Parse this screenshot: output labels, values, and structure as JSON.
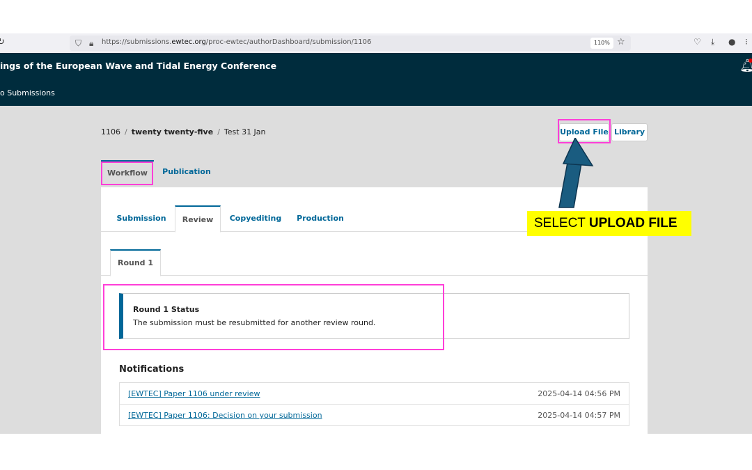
{
  "browser": {
    "url_prefix": "https://submissions.",
    "url_domain": "ewtec.org",
    "url_suffix": "/proc-ewtec/authorDashboard/submission/1106",
    "zoom": "110%"
  },
  "header": {
    "site_title": "ings of the European Wave and Tidal Energy Conference",
    "back_link": "o Submissions"
  },
  "breadcrumb": {
    "id": "1106",
    "series": "twenty twenty-five",
    "title": "Test 31 Jan"
  },
  "actions": {
    "upload_file": "Upload File",
    "library": "Library"
  },
  "top_tabs": {
    "workflow": "Workflow",
    "publication": "Publication"
  },
  "stage_tabs": {
    "submission": "Submission",
    "review": "Review",
    "copyediting": "Copyediting",
    "production": "Production"
  },
  "round": {
    "tab_label": "Round 1",
    "status_title": "Round 1 Status",
    "status_text": "The submission must be resubmitted for another review round."
  },
  "notifications": {
    "heading": "Notifications",
    "items": [
      {
        "label": "[EWTEC] Paper 1106 under review",
        "date": "2025-04-14 04:56 PM"
      },
      {
        "label": "[EWTEC] Paper 1106: Decision on your submission",
        "date": "2025-04-14 04:57 PM"
      }
    ]
  },
  "annotation": {
    "callout_prefix": "SELECT ",
    "callout_bold": "UPLOAD FILE",
    "highlight_color": "#ff3fd8",
    "arrow_color": "#1a5c80",
    "callout_bg": "#ffff00"
  },
  "colors": {
    "header_bg": "#002c3d",
    "link": "#006798",
    "page_bg": "#dddddd"
  }
}
